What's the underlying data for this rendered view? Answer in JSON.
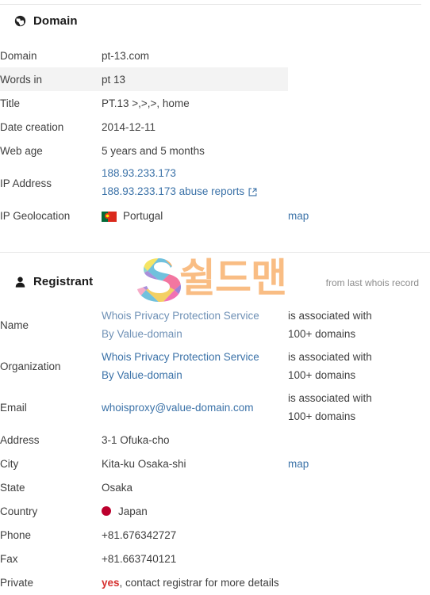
{
  "domain_section": {
    "icon": "globe-icon",
    "title": "Domain",
    "rows": [
      {
        "label": "Domain",
        "value": "pt-13.com",
        "zebra": false
      },
      {
        "label": "Words in",
        "value": "pt 13",
        "zebra": true
      },
      {
        "label": "Title",
        "value": "PT.13 >,>,>, home",
        "zebra": false
      },
      {
        "label": "Date creation",
        "value": "2014-12-11",
        "zebra": false
      },
      {
        "label": "Web age",
        "value": "5 years and 5 months",
        "zebra": false
      }
    ],
    "ip": {
      "label": "IP Address",
      "value": "188.93.233.173",
      "abuse_link": "188.93.233.173 abuse reports",
      "abuse_icon": "external-link-icon"
    },
    "geo": {
      "label": "IP Geolocation",
      "flag": "flag-portugal",
      "country": "Portugal",
      "map_link": "map"
    }
  },
  "registrant_section": {
    "icon": "user-icon",
    "title": "Registrant",
    "source_note": "from last whois record",
    "name": {
      "label": "Name",
      "link_line1": "Whois Privacy Protection Service",
      "link_line2": "By Value-domain",
      "assoc_line1": "is associated with",
      "assoc_line2": "100+ domains"
    },
    "organization": {
      "label": "Organization",
      "link_line1": "Whois Privacy Protection Service",
      "link_line2": "By Value-domain",
      "assoc_line1": "is associated with",
      "assoc_line2": "100+ domains"
    },
    "email": {
      "label": "Email",
      "value": "whoisproxy@value-domain.com",
      "assoc_line1": "is associated with",
      "assoc_line2": "100+ domains"
    },
    "address": {
      "label": "Address",
      "value": "3-1 Ofuka-cho"
    },
    "city": {
      "label": "City",
      "value": "Kita-ku Osaka-shi",
      "map_link": "map"
    },
    "state": {
      "label": "State",
      "value": "Osaka"
    },
    "country": {
      "label": "Country",
      "flag": "flag-japan",
      "value": "Japan"
    },
    "phone": {
      "label": "Phone",
      "value": "+81.676342727"
    },
    "fax": {
      "label": "Fax",
      "value": "+81.663740121"
    },
    "private": {
      "label": "Private",
      "flag_word": "yes",
      "rest": ", contact registrar for more details"
    }
  },
  "watermark": {
    "logo": "s-logo-icon",
    "text": "쉴드맨"
  },
  "colors": {
    "link": "#3b72a8",
    "zebra": "#f3f3f3",
    "accent_red": "#d63230",
    "watermark_orange": "#f9b87a"
  }
}
